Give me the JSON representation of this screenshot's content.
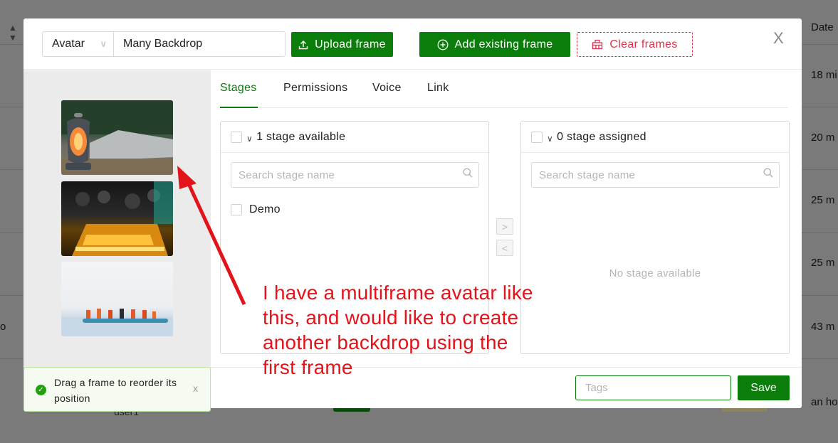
{
  "background": {
    "column_header": "Date",
    "rows": [
      "18 mi",
      "20 m",
      "25 m",
      "25 m",
      "43 m",
      "an ho"
    ],
    "left_fragment": "o",
    "user_text": "user1"
  },
  "header": {
    "type_select_value": "Avatar",
    "name_value": "Many Backdrop",
    "upload_label": "Upload frame",
    "add_existing_label": "Add existing frame",
    "clear_label": "Clear frames",
    "close_label": "X"
  },
  "frames": [
    {
      "name": "lantern-camp-frame"
    },
    {
      "name": "candles-crowd-frame"
    },
    {
      "name": "kayak-lake-frame"
    }
  ],
  "toast": {
    "message": "Drag a frame to reorder its position",
    "close_label": "x"
  },
  "tabs": [
    "Stages",
    "Permissions",
    "Voice",
    "Link"
  ],
  "transfer": {
    "left": {
      "title": "1 stage available",
      "search_placeholder": "Search stage name",
      "items": [
        "Demo"
      ]
    },
    "right": {
      "title": "0 stage assigned",
      "search_placeholder": "Search stage name",
      "empty": "No stage available"
    },
    "move_right": ">",
    "move_left": "<"
  },
  "footer": {
    "tags_placeholder": "Tags",
    "save_label": "Save"
  },
  "annotation": {
    "text": "I have a multiframe avatar like this, and would like to create another backdrop using the first frame",
    "color": "#e3131a"
  },
  "colors": {
    "primary": "#0a7d0a",
    "danger": "#e0314b",
    "success": "#21a20c"
  }
}
